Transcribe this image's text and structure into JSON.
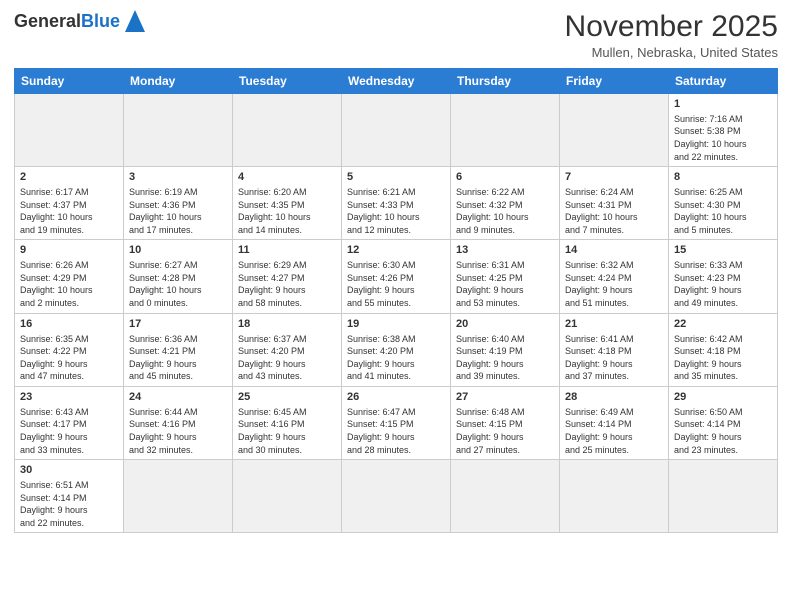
{
  "logo": {
    "text_general": "General",
    "text_blue": "Blue"
  },
  "header": {
    "month_year": "November 2025",
    "location": "Mullen, Nebraska, United States"
  },
  "weekdays": [
    "Sunday",
    "Monday",
    "Tuesday",
    "Wednesday",
    "Thursday",
    "Friday",
    "Saturday"
  ],
  "weeks": [
    [
      {
        "day": "",
        "info": ""
      },
      {
        "day": "",
        "info": ""
      },
      {
        "day": "",
        "info": ""
      },
      {
        "day": "",
        "info": ""
      },
      {
        "day": "",
        "info": ""
      },
      {
        "day": "",
        "info": ""
      },
      {
        "day": "1",
        "info": "Sunrise: 7:16 AM\nSunset: 5:38 PM\nDaylight: 10 hours\nand 22 minutes."
      }
    ],
    [
      {
        "day": "2",
        "info": "Sunrise: 6:17 AM\nSunset: 4:37 PM\nDaylight: 10 hours\nand 19 minutes."
      },
      {
        "day": "3",
        "info": "Sunrise: 6:19 AM\nSunset: 4:36 PM\nDaylight: 10 hours\nand 17 minutes."
      },
      {
        "day": "4",
        "info": "Sunrise: 6:20 AM\nSunset: 4:35 PM\nDaylight: 10 hours\nand 14 minutes."
      },
      {
        "day": "5",
        "info": "Sunrise: 6:21 AM\nSunset: 4:33 PM\nDaylight: 10 hours\nand 12 minutes."
      },
      {
        "day": "6",
        "info": "Sunrise: 6:22 AM\nSunset: 4:32 PM\nDaylight: 10 hours\nand 9 minutes."
      },
      {
        "day": "7",
        "info": "Sunrise: 6:24 AM\nSunset: 4:31 PM\nDaylight: 10 hours\nand 7 minutes."
      },
      {
        "day": "8",
        "info": "Sunrise: 6:25 AM\nSunset: 4:30 PM\nDaylight: 10 hours\nand 5 minutes."
      }
    ],
    [
      {
        "day": "9",
        "info": "Sunrise: 6:26 AM\nSunset: 4:29 PM\nDaylight: 10 hours\nand 2 minutes."
      },
      {
        "day": "10",
        "info": "Sunrise: 6:27 AM\nSunset: 4:28 PM\nDaylight: 10 hours\nand 0 minutes."
      },
      {
        "day": "11",
        "info": "Sunrise: 6:29 AM\nSunset: 4:27 PM\nDaylight: 9 hours\nand 58 minutes."
      },
      {
        "day": "12",
        "info": "Sunrise: 6:30 AM\nSunset: 4:26 PM\nDaylight: 9 hours\nand 55 minutes."
      },
      {
        "day": "13",
        "info": "Sunrise: 6:31 AM\nSunset: 4:25 PM\nDaylight: 9 hours\nand 53 minutes."
      },
      {
        "day": "14",
        "info": "Sunrise: 6:32 AM\nSunset: 4:24 PM\nDaylight: 9 hours\nand 51 minutes."
      },
      {
        "day": "15",
        "info": "Sunrise: 6:33 AM\nSunset: 4:23 PM\nDaylight: 9 hours\nand 49 minutes."
      }
    ],
    [
      {
        "day": "16",
        "info": "Sunrise: 6:35 AM\nSunset: 4:22 PM\nDaylight: 9 hours\nand 47 minutes."
      },
      {
        "day": "17",
        "info": "Sunrise: 6:36 AM\nSunset: 4:21 PM\nDaylight: 9 hours\nand 45 minutes."
      },
      {
        "day": "18",
        "info": "Sunrise: 6:37 AM\nSunset: 4:20 PM\nDaylight: 9 hours\nand 43 minutes."
      },
      {
        "day": "19",
        "info": "Sunrise: 6:38 AM\nSunset: 4:20 PM\nDaylight: 9 hours\nand 41 minutes."
      },
      {
        "day": "20",
        "info": "Sunrise: 6:40 AM\nSunset: 4:19 PM\nDaylight: 9 hours\nand 39 minutes."
      },
      {
        "day": "21",
        "info": "Sunrise: 6:41 AM\nSunset: 4:18 PM\nDaylight: 9 hours\nand 37 minutes."
      },
      {
        "day": "22",
        "info": "Sunrise: 6:42 AM\nSunset: 4:18 PM\nDaylight: 9 hours\nand 35 minutes."
      }
    ],
    [
      {
        "day": "23",
        "info": "Sunrise: 6:43 AM\nSunset: 4:17 PM\nDaylight: 9 hours\nand 33 minutes."
      },
      {
        "day": "24",
        "info": "Sunrise: 6:44 AM\nSunset: 4:16 PM\nDaylight: 9 hours\nand 32 minutes."
      },
      {
        "day": "25",
        "info": "Sunrise: 6:45 AM\nSunset: 4:16 PM\nDaylight: 9 hours\nand 30 minutes."
      },
      {
        "day": "26",
        "info": "Sunrise: 6:47 AM\nSunset: 4:15 PM\nDaylight: 9 hours\nand 28 minutes."
      },
      {
        "day": "27",
        "info": "Sunrise: 6:48 AM\nSunset: 4:15 PM\nDaylight: 9 hours\nand 27 minutes."
      },
      {
        "day": "28",
        "info": "Sunrise: 6:49 AM\nSunset: 4:14 PM\nDaylight: 9 hours\nand 25 minutes."
      },
      {
        "day": "29",
        "info": "Sunrise: 6:50 AM\nSunset: 4:14 PM\nDaylight: 9 hours\nand 23 minutes."
      }
    ],
    [
      {
        "day": "30",
        "info": "Sunrise: 6:51 AM\nSunset: 4:14 PM\nDaylight: 9 hours\nand 22 minutes."
      },
      {
        "day": "",
        "info": ""
      },
      {
        "day": "",
        "info": ""
      },
      {
        "day": "",
        "info": ""
      },
      {
        "day": "",
        "info": ""
      },
      {
        "day": "",
        "info": ""
      },
      {
        "day": "",
        "info": ""
      }
    ]
  ]
}
